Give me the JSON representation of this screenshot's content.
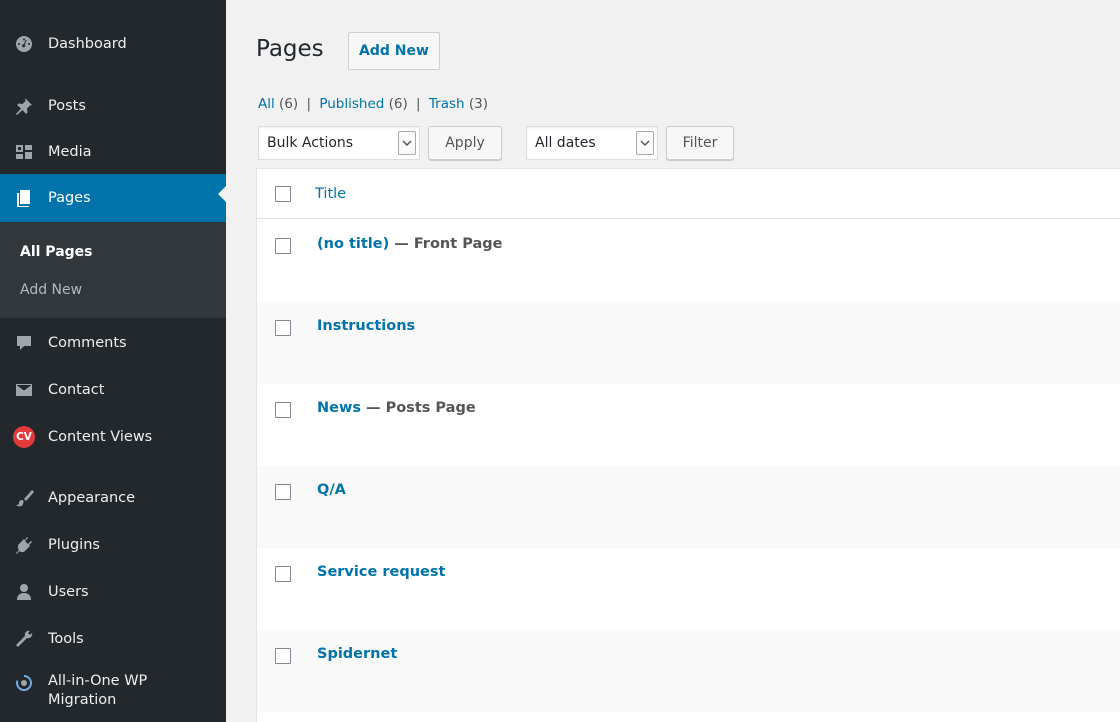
{
  "sidebar": {
    "items": [
      {
        "label": "Dashboard",
        "icon": "dashboard-icon"
      },
      {
        "label": "Posts",
        "icon": "pin-icon"
      },
      {
        "label": "Media",
        "icon": "media-icon"
      },
      {
        "label": "Pages",
        "icon": "pages-icon",
        "active": true
      },
      {
        "label": "Comments",
        "icon": "comment-icon"
      },
      {
        "label": "Contact",
        "icon": "envelope-icon"
      },
      {
        "label": "Content Views",
        "icon": "content-views-icon",
        "badge": "CV"
      },
      {
        "label": "Appearance",
        "icon": "brush-icon"
      },
      {
        "label": "Plugins",
        "icon": "plugin-icon"
      },
      {
        "label": "Users",
        "icon": "users-icon"
      },
      {
        "label": "Tools",
        "icon": "wrench-icon"
      },
      {
        "label": "All-in-One WP Migration",
        "icon": "migration-icon"
      }
    ],
    "submenu": [
      {
        "label": "All Pages",
        "current": true
      },
      {
        "label": "Add New"
      }
    ]
  },
  "header": {
    "title": "Pages",
    "add_new": "Add New"
  },
  "filters": {
    "all": "All",
    "all_count": "(6)",
    "published": "Published",
    "published_count": "(6)",
    "trash": "Trash",
    "trash_count": "(3)",
    "separator": "|"
  },
  "toolbar": {
    "bulk_actions": "Bulk Actions",
    "apply": "Apply",
    "dates": "All dates",
    "filter": "Filter"
  },
  "table": {
    "header_title": "Title",
    "rows": [
      {
        "title": "(no title)",
        "state": " — Front Page"
      },
      {
        "title": "Instructions",
        "state": ""
      },
      {
        "title": "News",
        "state": " — Posts Page"
      },
      {
        "title": "Q/A",
        "state": ""
      },
      {
        "title": "Service request",
        "state": ""
      },
      {
        "title": "Spidernet",
        "state": ""
      }
    ]
  },
  "colors": {
    "sidebar_bg": "#23282d",
    "submenu_bg": "#32373c",
    "accent": "#0073aa",
    "page_bg": "#f1f1f1"
  }
}
